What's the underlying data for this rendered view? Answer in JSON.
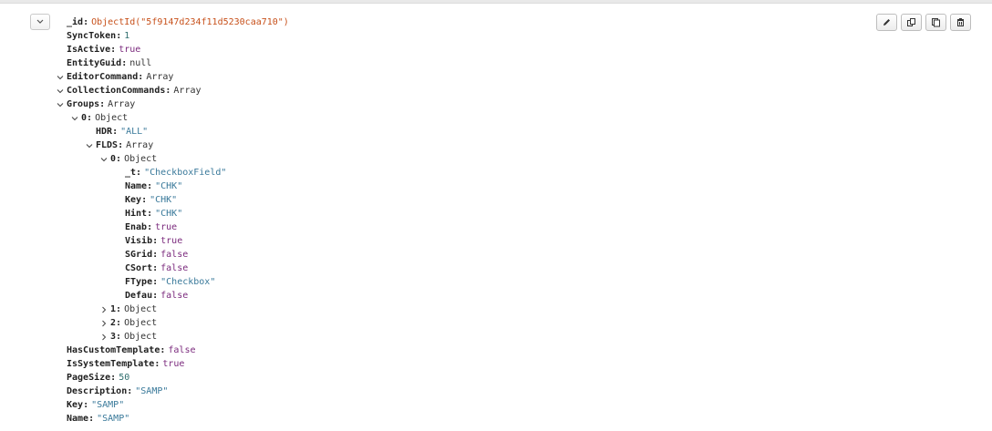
{
  "document": {
    "id_key": "_id",
    "id_value": "ObjectId(\"5f9147d234f11d5230caa710\")",
    "fields": [
      {
        "key": "SyncToken",
        "value": "1",
        "type": "num",
        "indent": 0
      },
      {
        "key": "IsActive",
        "value": "true",
        "type": "bool",
        "indent": 0
      },
      {
        "key": "EntityGuid",
        "value": "null",
        "type": "null",
        "indent": 0
      },
      {
        "key": "EditorCommand",
        "value": "Array",
        "type": "type",
        "indent": 0,
        "toggle": "expanded"
      },
      {
        "key": "CollectionCommands",
        "value": "Array",
        "type": "type",
        "indent": 0,
        "toggle": "expanded"
      },
      {
        "key": "Groups",
        "value": "Array",
        "type": "type",
        "indent": 0,
        "toggle": "expanded"
      },
      {
        "key": "0",
        "value": "Object",
        "type": "type",
        "indent": 1,
        "toggle": "expanded"
      },
      {
        "key": "HDR",
        "value": "\"ALL\"",
        "type": "str",
        "indent": 2
      },
      {
        "key": "FLDS",
        "value": "Array",
        "type": "type",
        "indent": 2,
        "toggle": "expanded"
      },
      {
        "key": "0",
        "value": "Object",
        "type": "type",
        "indent": 3,
        "toggle": "expanded"
      },
      {
        "key": "_t",
        "value": "\"CheckboxField\"",
        "type": "str",
        "indent": 4
      },
      {
        "key": "Name",
        "value": "\"CHK\"",
        "type": "str",
        "indent": 4
      },
      {
        "key": "Key",
        "value": "\"CHK\"",
        "type": "str",
        "indent": 4
      },
      {
        "key": "Hint",
        "value": "\"CHK\"",
        "type": "str",
        "indent": 4
      },
      {
        "key": "Enab",
        "value": "true",
        "type": "bool",
        "indent": 4
      },
      {
        "key": "Visib",
        "value": "true",
        "type": "bool",
        "indent": 4
      },
      {
        "key": "SGrid",
        "value": "false",
        "type": "bool",
        "indent": 4
      },
      {
        "key": "CSort",
        "value": "false",
        "type": "bool",
        "indent": 4
      },
      {
        "key": "FType",
        "value": "\"Checkbox\"",
        "type": "str",
        "indent": 4
      },
      {
        "key": "Defau",
        "value": "false",
        "type": "bool",
        "indent": 4
      },
      {
        "key": "1",
        "value": "Object",
        "type": "type",
        "indent": 3,
        "toggle": "collapsed"
      },
      {
        "key": "2",
        "value": "Object",
        "type": "type",
        "indent": 3,
        "toggle": "collapsed"
      },
      {
        "key": "3",
        "value": "Object",
        "type": "type",
        "indent": 3,
        "toggle": "collapsed"
      },
      {
        "key": "HasCustomTemplate",
        "value": "false",
        "type": "bool",
        "indent": 0
      },
      {
        "key": "IsSystemTemplate",
        "value": "true",
        "type": "bool",
        "indent": 0
      },
      {
        "key": "PageSize",
        "value": "50",
        "type": "num",
        "indent": 0
      },
      {
        "key": "Description",
        "value": "\"SAMP\"",
        "type": "str",
        "indent": 0
      },
      {
        "key": "Key",
        "value": "\"SAMP\"",
        "type": "str",
        "indent": 0
      },
      {
        "key": "Name",
        "value": "\"SAMP\"",
        "type": "str",
        "indent": 0
      }
    ]
  },
  "toolbar": {
    "buttons": [
      {
        "name": "edit-document-button",
        "icon": "pencil-icon"
      },
      {
        "name": "copy-document-button",
        "icon": "copy-icon"
      },
      {
        "name": "clone-document-button",
        "icon": "clone-icon"
      },
      {
        "name": "delete-document-button",
        "icon": "trash-icon"
      }
    ]
  },
  "colors": {
    "string": "#39799a",
    "boolean": "#7b2a7d",
    "number": "#2f6e6e",
    "objectid": "#c7501a"
  }
}
